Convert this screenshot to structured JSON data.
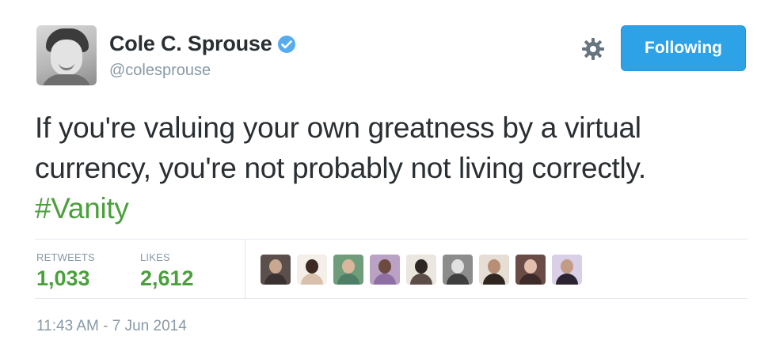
{
  "user": {
    "display_name": "Cole C. Sprouse",
    "handle": "@colesprouse",
    "verified": true,
    "avatar_icon": "profile-photo"
  },
  "actions": {
    "settings_icon": "gear-icon",
    "follow_label": "Following",
    "follow_color": "#2ea2e7"
  },
  "tweet": {
    "line1": "If you're valuing your own greatness by a virtual",
    "line2": "currency, you're not probably not living correctly.",
    "hashtag": "#Vanity",
    "hashtag_color": "#4b9f3c"
  },
  "stats": {
    "retweets_label": "RETWEETS",
    "retweets_count": "1,033",
    "likes_label": "LIKES",
    "likes_count": "2,612"
  },
  "likers": [
    {
      "name": "liker-avatar",
      "bg": "#5a4f4a",
      "head": "#c9a88f",
      "body": "#3a3232"
    },
    {
      "name": "liker-avatar",
      "bg": "#f4efe8",
      "head": "#3d2a22",
      "body": "#d7c1ad"
    },
    {
      "name": "liker-avatar",
      "bg": "#6f9d7b",
      "head": "#d8b79c",
      "body": "#4d7f67"
    },
    {
      "name": "liker-avatar",
      "bg": "#b9a2c4",
      "head": "#6c4b3e",
      "body": "#8f6fa3"
    },
    {
      "name": "liker-avatar",
      "bg": "#ece6e0",
      "head": "#2e2624",
      "body": "#5d4d48"
    },
    {
      "name": "liker-avatar",
      "bg": "#8c8c8c",
      "head": "#e1e1e1",
      "body": "#3f3f3f"
    },
    {
      "name": "liker-avatar",
      "bg": "#e6ddd4",
      "head": "#b88f74",
      "body": "#2f2622"
    },
    {
      "name": "liker-avatar",
      "bg": "#6a4b46",
      "head": "#e2c0ad",
      "body": "#3c2b29"
    },
    {
      "name": "liker-avatar",
      "bg": "#d9cfe6",
      "head": "#c49c86",
      "body": "#2c2430"
    }
  ],
  "timestamp": "11:43 AM - 7 Jun 2014"
}
